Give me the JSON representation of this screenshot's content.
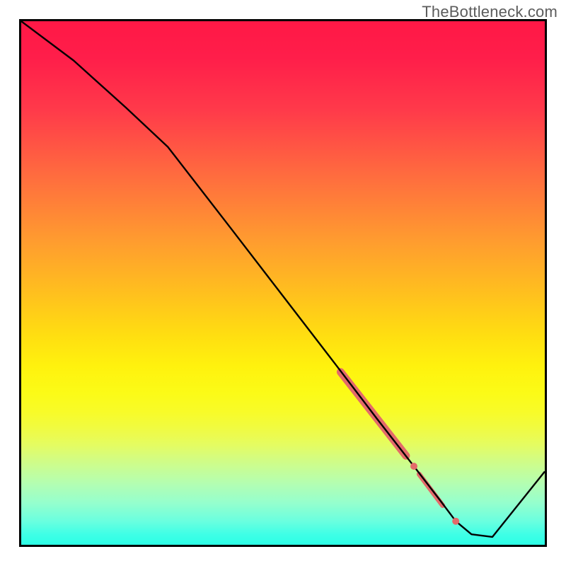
{
  "watermark": "TheBottleneck.com",
  "chart_data": {
    "type": "line",
    "title": "",
    "xlabel": "",
    "ylabel": "",
    "xlim": [
      0,
      100
    ],
    "ylim": [
      0,
      100
    ],
    "series": [
      {
        "name": "bottleneck-curve",
        "x": [
          0,
          10,
          20,
          28,
          40,
          50,
          60,
          68,
          75,
          80,
          83,
          86,
          90,
          100
        ],
        "y": [
          100,
          92.5,
          83.5,
          76,
          60.5,
          47.5,
          34.5,
          24,
          15,
          8.5,
          4.5,
          2,
          1.5,
          14
        ],
        "color": "#000000",
        "line_width": 2.4
      }
    ],
    "highlight_segments": [
      {
        "name": "thick-segment",
        "x": [
          61,
          73.5
        ],
        "y": [
          33,
          17
        ],
        "color": "#e36a6a",
        "line_width": 11,
        "cap": "round"
      },
      {
        "name": "thin-segment",
        "x": [
          76,
          80.5
        ],
        "y": [
          13.5,
          7.5
        ],
        "color": "#e36a6a",
        "line_width": 7,
        "cap": "round"
      }
    ],
    "highlight_points": [
      {
        "x": 75,
        "y": 15,
        "r": 5,
        "color": "#e36a6a"
      },
      {
        "x": 83,
        "y": 4.5,
        "r": 5,
        "color": "#e36a6a"
      }
    ]
  }
}
